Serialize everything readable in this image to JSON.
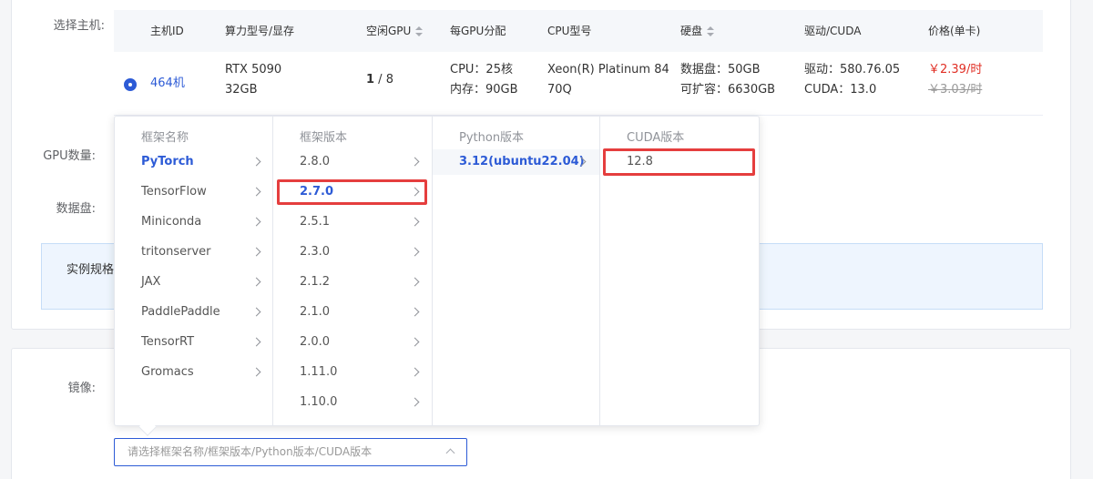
{
  "labels": {
    "host": "选择主机:",
    "gpu_count": "GPU数量:",
    "data_disk": "数据盘:",
    "instance_spec": "实例规格",
    "image": "镜像:"
  },
  "table": {
    "headers": [
      "主机ID",
      "算力型号/显存",
      "空闲GPU",
      "每GPU分配",
      "CPU型号",
      "硬盘",
      "驱动/CUDA",
      "价格(单卡)"
    ],
    "row": {
      "host_id": "464机",
      "gpu_model": "RTX 5090",
      "vram": "32GB",
      "free_gpu": "1",
      "total_gpu": " / 8",
      "cpu_alloc": "CPU：25核",
      "mem_alloc": "内存：90GB",
      "cpu_model_1": "Xeon(R) Platinum 84",
      "cpu_model_2": "70Q",
      "disk_1": "数据盘：50GB",
      "disk_2": "可扩容：6630GB",
      "driver": "驱动：580.76.05",
      "cuda": "CUDA：13.0",
      "price": "￥2.39/时",
      "orig_price": "￥3.03/时"
    }
  },
  "cascader": {
    "columns": [
      {
        "title": "框架名称",
        "items": [
          "PyTorch",
          "TensorFlow",
          "Miniconda",
          "tritonserver",
          "JAX",
          "PaddlePaddle",
          "TensorRT",
          "Gromacs"
        ]
      },
      {
        "title": "框架版本",
        "items": [
          "2.8.0",
          "2.7.0",
          "2.5.1",
          "2.3.0",
          "2.1.2",
          "2.1.0",
          "2.0.0",
          "1.11.0",
          "1.10.0"
        ]
      },
      {
        "title": "Python版本",
        "items": [
          "3.12(ubuntu22.04)"
        ]
      },
      {
        "title": "CUDA版本",
        "items": [
          "12.8"
        ]
      }
    ]
  },
  "image_select": {
    "placeholder": "请选择框架名称/框架版本/Python版本/CUDA版本"
  },
  "colors": {
    "primary": "#2d5bd6",
    "price": "#e02e24",
    "highlight": "#e53e3e"
  }
}
